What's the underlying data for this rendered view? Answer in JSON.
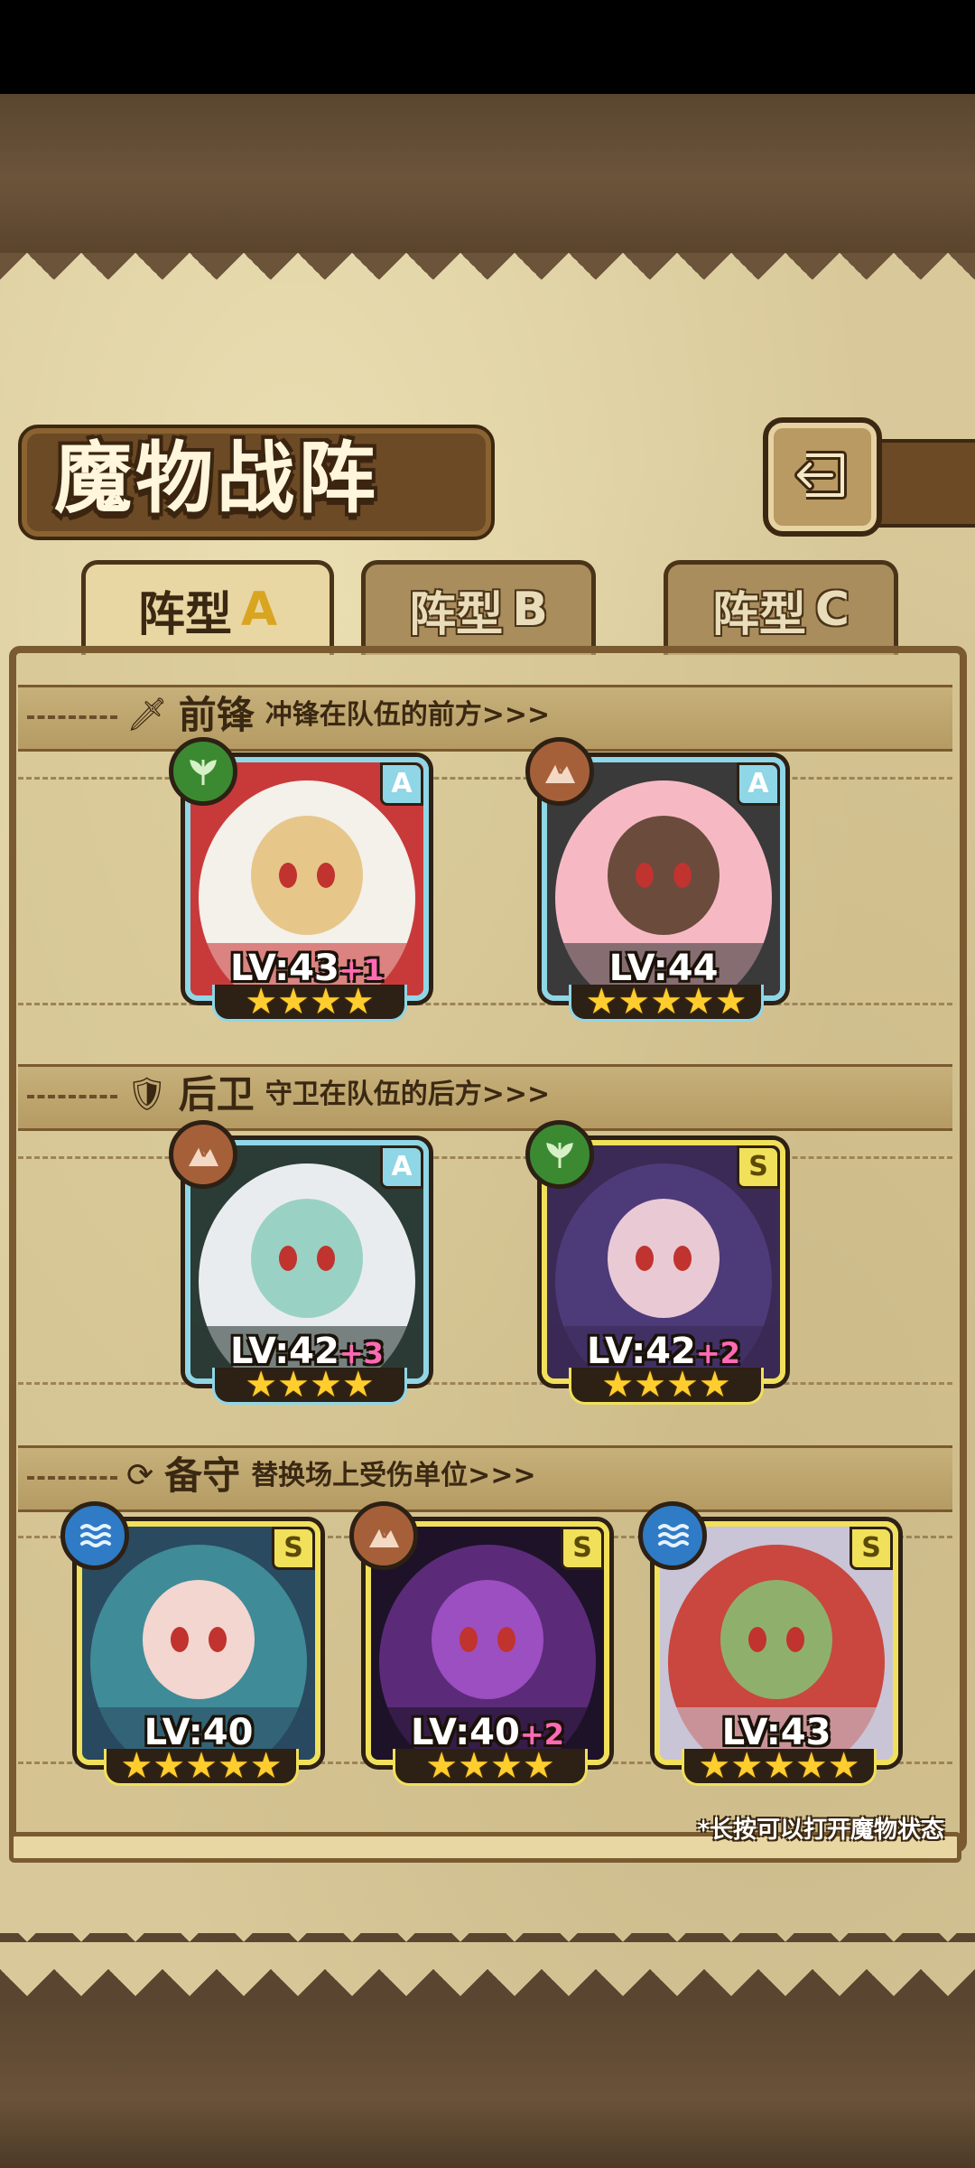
{
  "header": {
    "title": "魔物战阵"
  },
  "tabs": [
    {
      "prefix": "阵型",
      "letter": "A",
      "active": true
    },
    {
      "prefix": "阵型",
      "letter": "B",
      "active": false
    },
    {
      "prefix": "阵型",
      "letter": "C",
      "active": false
    }
  ],
  "sections": {
    "front": {
      "title": "前锋",
      "desc": "冲锋在队伍的前方>>>",
      "icon": "sword-icon"
    },
    "rear": {
      "title": "后卫",
      "desc": "守卫在队伍的后方>>>",
      "icon": "shield-icon"
    },
    "reserve": {
      "title": "备守",
      "desc": "替换场上受伤单位>>>",
      "icon": "swap-icon"
    }
  },
  "cards": {
    "front": [
      {
        "element": "grass",
        "rank": "A",
        "level": "LV:43",
        "plus": "+1",
        "stars": "★★★★",
        "palette": [
          "#f4f0ea",
          "#e7c68a",
          "#c83a3a"
        ]
      },
      {
        "element": "rock",
        "rank": "A",
        "level": "LV:44",
        "plus": "",
        "stars": "★★★★★",
        "palette": [
          "#f6b9c4",
          "#6b4b3c",
          "#3a3a3a"
        ]
      }
    ],
    "rear": [
      {
        "element": "rock",
        "rank": "A",
        "level": "LV:42",
        "plus": "+3",
        "stars": "★★★★",
        "palette": [
          "#e9ecef",
          "#9ad1c5",
          "#2b3b36"
        ]
      },
      {
        "element": "grass",
        "rank": "S",
        "level": "LV:42",
        "plus": "+2",
        "stars": "★★★★",
        "palette": [
          "#4d3b79",
          "#e9c9d4",
          "#3a2a55"
        ]
      }
    ],
    "reserve": [
      {
        "element": "water",
        "rank": "S",
        "level": "LV:40",
        "plus": "",
        "stars": "★★★★★",
        "palette": [
          "#3f8b97",
          "#f2d6cf",
          "#2a4a60"
        ]
      },
      {
        "element": "rock",
        "rank": "S",
        "level": "LV:40",
        "plus": "+2",
        "stars": "★★★★",
        "palette": [
          "#5b2b7a",
          "#9c4fc0",
          "#1e1228"
        ]
      },
      {
        "element": "water",
        "rank": "S",
        "level": "LV:43",
        "plus": "",
        "stars": "★★★★★",
        "palette": [
          "#c9473e",
          "#8fb06d",
          "#c9c4d6"
        ]
      }
    ]
  },
  "footer": {
    "hint": "*长按可以打开魔物状态"
  },
  "colors": {
    "rankA": "#8fd6e6",
    "rankS": "#f1e05a",
    "star": "#ffce2e",
    "plus": "#ff6ab5"
  }
}
